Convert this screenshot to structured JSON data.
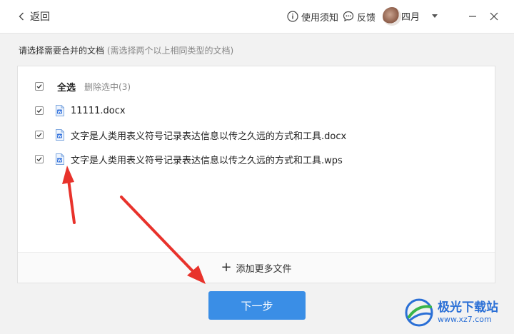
{
  "header": {
    "back_label": "返回",
    "notice_label": "使用须知",
    "feedback_label": "反馈",
    "username": "四月"
  },
  "instruction": {
    "main": "请选择需要合并的文档",
    "hint": "(需选择两个以上相同类型的文档)"
  },
  "file_list": {
    "select_all_label": "全选",
    "delete_selected_label": "删除选中(3)",
    "files": [
      {
        "name": "11111.docx",
        "checked": true
      },
      {
        "name": "文字是人类用表义符号记录表达信息以传之久远的方式和工具.docx",
        "checked": true
      },
      {
        "name": "文字是人类用表义符号记录表达信息以传之久远的方式和工具.wps",
        "checked": true
      }
    ],
    "add_more_label": "添加更多文件"
  },
  "footer": {
    "next_label": "下一步"
  },
  "watermark": {
    "name": "极光下载站",
    "url": "www.xz7.com"
  },
  "colors": {
    "primary": "#3a8ee6",
    "annotation_arrow": "#e8322b"
  }
}
